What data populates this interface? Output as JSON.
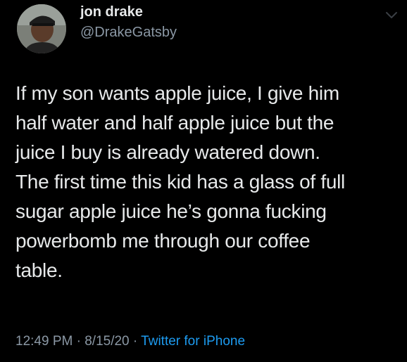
{
  "author": {
    "display_name": "jon drake",
    "handle": "@DrakeGatsby"
  },
  "tweet": {
    "lines": [
      "If my son wants apple juice, I give him",
      "half water and half apple juice but the",
      "juice I buy is already watered down.",
      "The first time this kid has a glass of full",
      "sugar apple juice he’s gonna fucking",
      "powerbomb me through our coffee",
      "table."
    ]
  },
  "meta": {
    "time": "12:49 PM",
    "separator": " · ",
    "date": "8/15/20",
    "source": "Twitter for iPhone"
  },
  "icons": {
    "more": "chevron-down-icon",
    "avatar": "avatar"
  },
  "colors": {
    "background": "#000000",
    "text": "#e7e9ea",
    "secondary": "#8b98a5",
    "link": "#1d9bf0"
  }
}
